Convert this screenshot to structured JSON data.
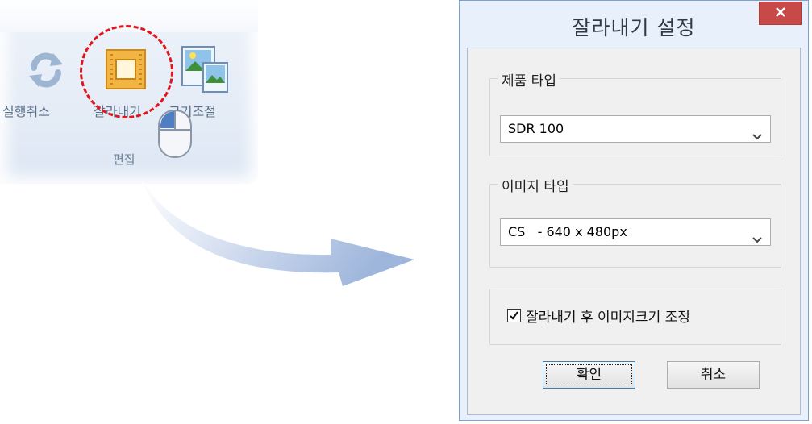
{
  "ribbon": {
    "buttons": [
      {
        "label": "실행취소",
        "icon": "undo-icon"
      },
      {
        "label": "잘라내기",
        "icon": "crop-icon"
      },
      {
        "label": "크기조절",
        "icon": "resize-image-icon"
      }
    ],
    "group_label": "편집"
  },
  "dialog": {
    "title": "잘라내기 설정",
    "close_icon": "close-icon",
    "product_group": {
      "legend": "제품 타입",
      "selected": "SDR 100"
    },
    "image_group": {
      "legend": "이미지 타입",
      "selected": "CS   - 640 x 480px"
    },
    "resize_checkbox": {
      "label": "잘라내기 후 이미지크기 조정",
      "checked": true
    },
    "ok_label": "확인",
    "cancel_label": "취소"
  },
  "colors": {
    "highlight": "#e3151a",
    "close_button": "#c74a49",
    "dialog_frame": "#e8f0fb"
  }
}
